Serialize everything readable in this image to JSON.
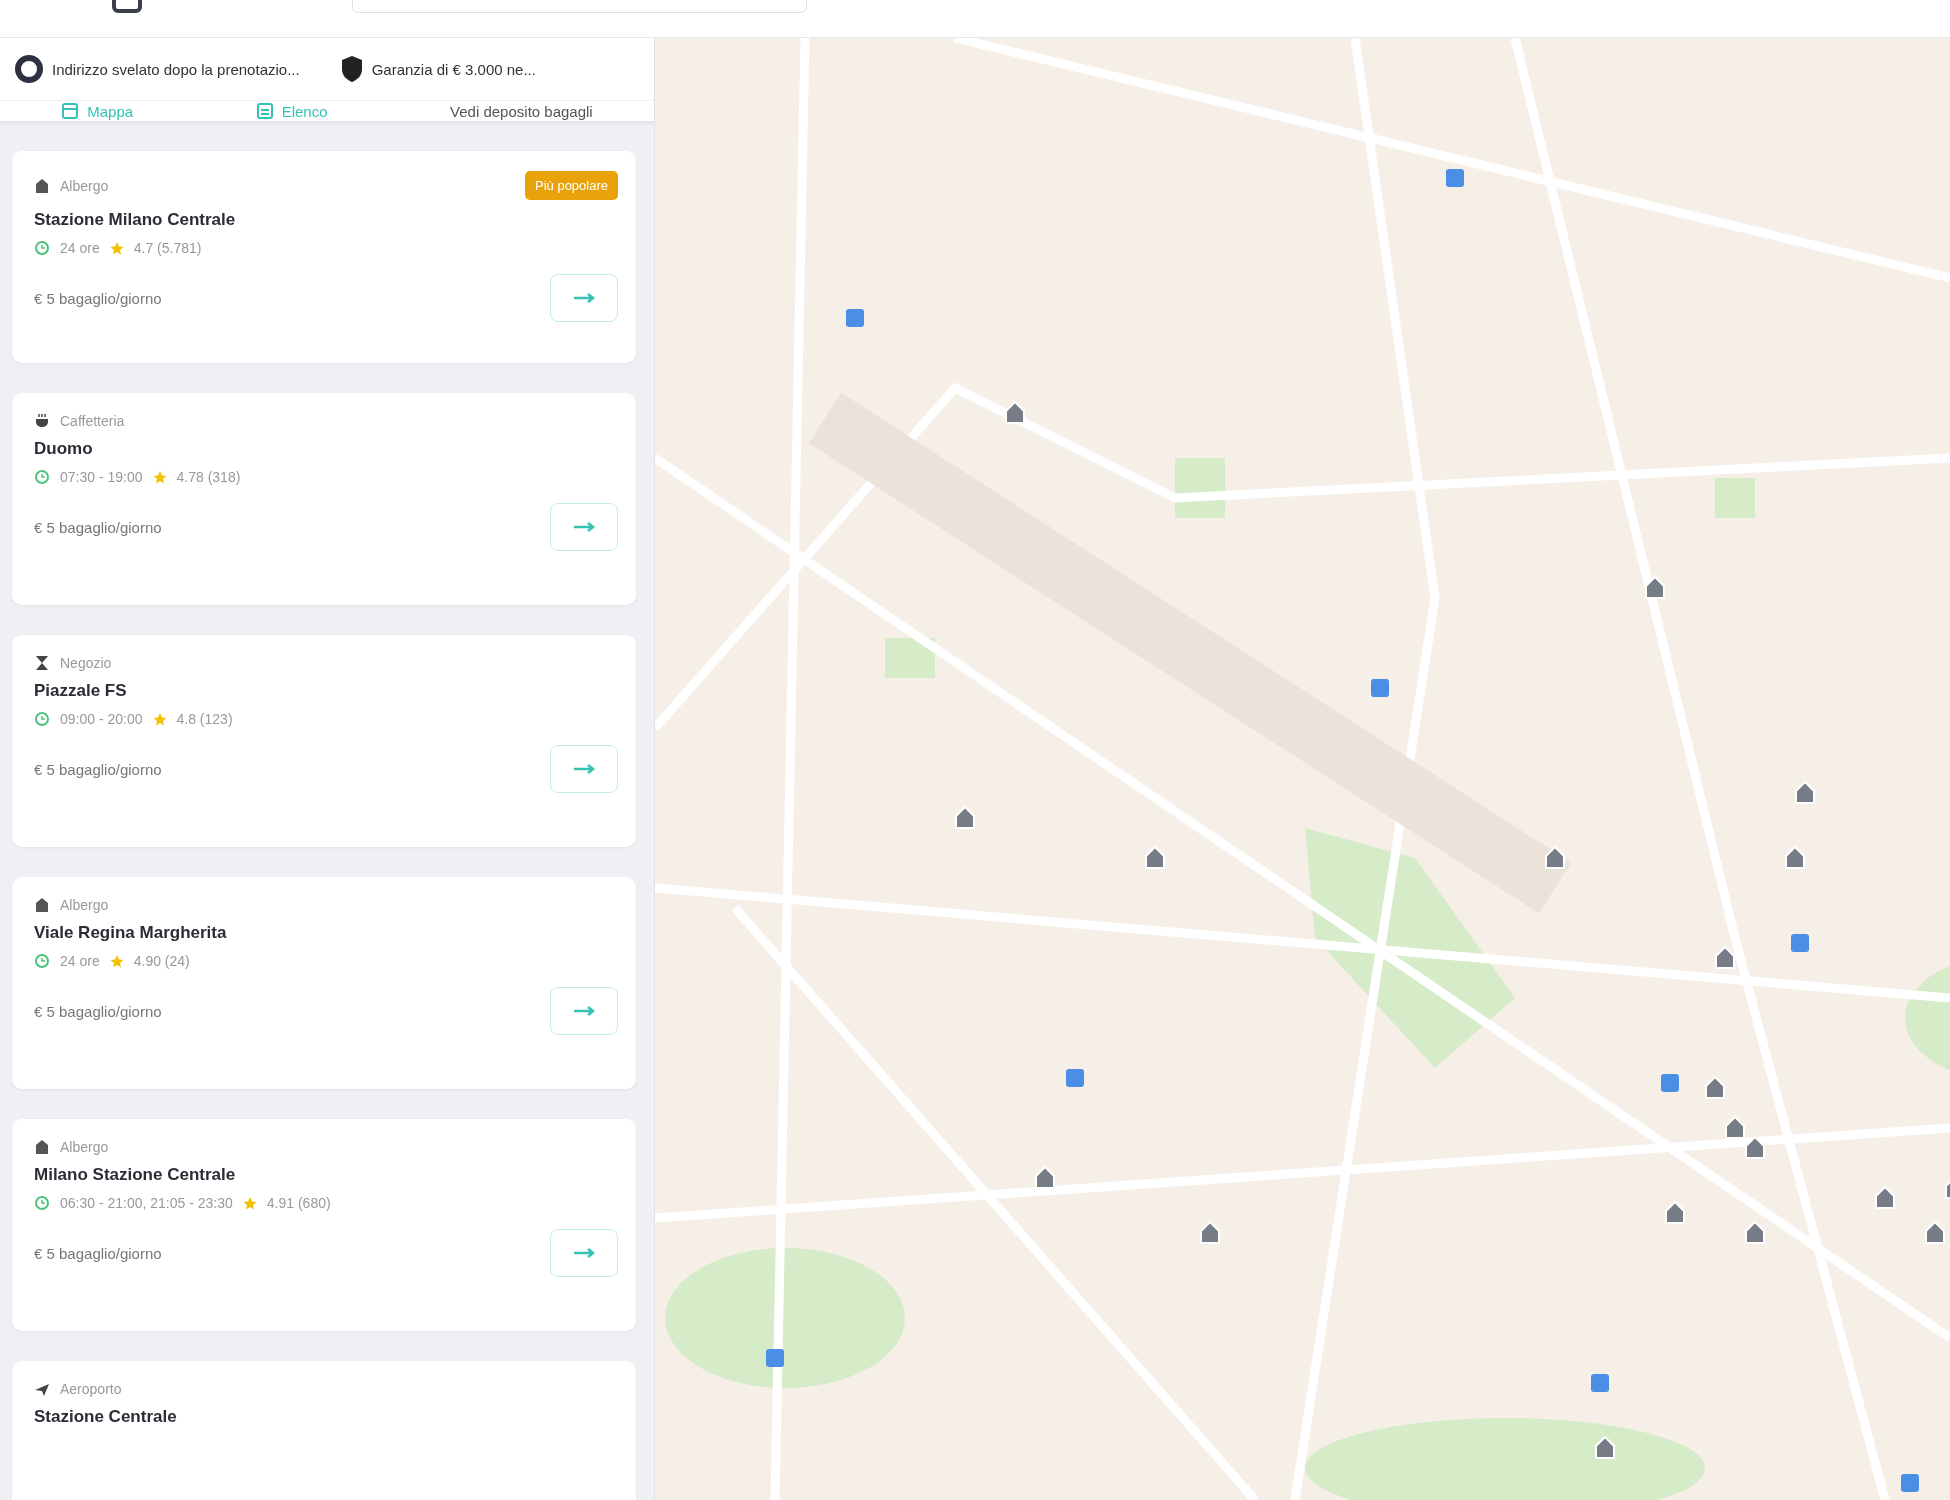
{
  "info_bar": [
    {
      "kind": "location",
      "text": "Indirizzo svelato dopo la prenotazio..."
    },
    {
      "kind": "shield",
      "text": "Garanzia di € 3.000 ne..."
    }
  ],
  "tabs": [
    {
      "label": "Mappa",
      "kind": "map",
      "active": true
    },
    {
      "label": "Elenco",
      "kind": "list",
      "active": true
    },
    {
      "label": "Vedi deposito bagagli",
      "kind": "plain",
      "active": false
    }
  ],
  "places": [
    {
      "category": "Albergo",
      "kind": "hotel",
      "name": "Stazione Milano Centrale",
      "hours": "24 ore",
      "rating": "4.7 (5.781)",
      "price": "€ 5 bagaglio/giorno",
      "badge": "Più popolare"
    },
    {
      "category": "Caffetteria",
      "kind": "cafe",
      "name": "Duomo",
      "hours": "07:30 - 19:00",
      "rating": "4.78 (318)",
      "price": "€ 5 bagaglio/giorno"
    },
    {
      "category": "Negozio",
      "kind": "shop",
      "name": "Piazzale FS",
      "hours": "09:00 - 20:00",
      "rating": "4.8 (123)",
      "price": "€ 5 bagaglio/giorno"
    },
    {
      "category": "Albergo",
      "kind": "hotel",
      "name": "Viale Regina Margherita",
      "hours": "24 ore",
      "rating": "4.90 (24)",
      "price": "€ 5 bagaglio/giorno"
    },
    {
      "category": "Albergo",
      "kind": "hotel",
      "name": "Milano Stazione Centrale",
      "hours": "06:30 - 21:00, 21:05 - 23:30",
      "rating": "4.91 (680)",
      "price": "€ 5 bagaglio/giorno"
    },
    {
      "category": "Aeroporto",
      "kind": "plane",
      "name": "Stazione Centrale"
    }
  ]
}
